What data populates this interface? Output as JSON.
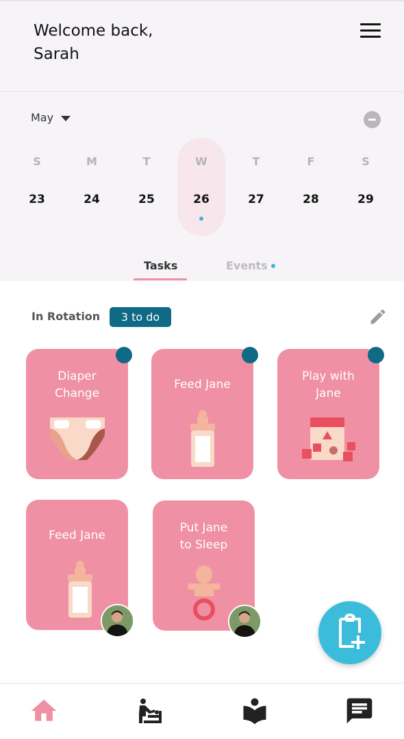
{
  "header": {
    "greeting": "Welcome back,",
    "user_name": "Sarah"
  },
  "calendar": {
    "month": "May",
    "days": [
      {
        "dow": "S",
        "date": "23"
      },
      {
        "dow": "M",
        "date": "24"
      },
      {
        "dow": "T",
        "date": "25"
      },
      {
        "dow": "W",
        "date": "26",
        "selected": true
      },
      {
        "dow": "T",
        "date": "27"
      },
      {
        "dow": "F",
        "date": "28"
      },
      {
        "dow": "S",
        "date": "29"
      }
    ]
  },
  "tabs": [
    {
      "label": "Tasks",
      "active": true
    },
    {
      "label": "Events",
      "has_indicator": true
    }
  ],
  "rotation": {
    "label": "In Rotation",
    "badge": "3 to do"
  },
  "tasks": [
    {
      "title_line1": "Diaper",
      "title_line2": "Change",
      "icon": "diaper-icon",
      "unassigned_dot": true
    },
    {
      "title_line1": "Feed Jane",
      "title_line2": "",
      "icon": "bottle-icon",
      "unassigned_dot": true
    },
    {
      "title_line1": "Play with",
      "title_line2": "Jane",
      "icon": "blocks-icon",
      "unassigned_dot": true
    },
    {
      "title_line1": "Feed Jane",
      "title_line2": "",
      "icon": "bottle-icon",
      "assignee_avatar": true
    },
    {
      "title_line1": "Put Jane",
      "title_line2": "to Sleep",
      "icon": "pacifier-icon",
      "assignee_avatar": true
    }
  ],
  "fab": {
    "icon": "add-task-clipboard-icon"
  },
  "bottom_nav": [
    {
      "icon": "home-icon",
      "active": true
    },
    {
      "icon": "baby-changing-icon"
    },
    {
      "icon": "reading-icon"
    },
    {
      "icon": "chat-icon"
    }
  ],
  "colors": {
    "accent_pink": "#ef8fa3",
    "card_pink": "#ef90a4",
    "teal": "#0e6a85",
    "cyan": "#3cbcdb",
    "header_bg": "#f6f4f7"
  }
}
